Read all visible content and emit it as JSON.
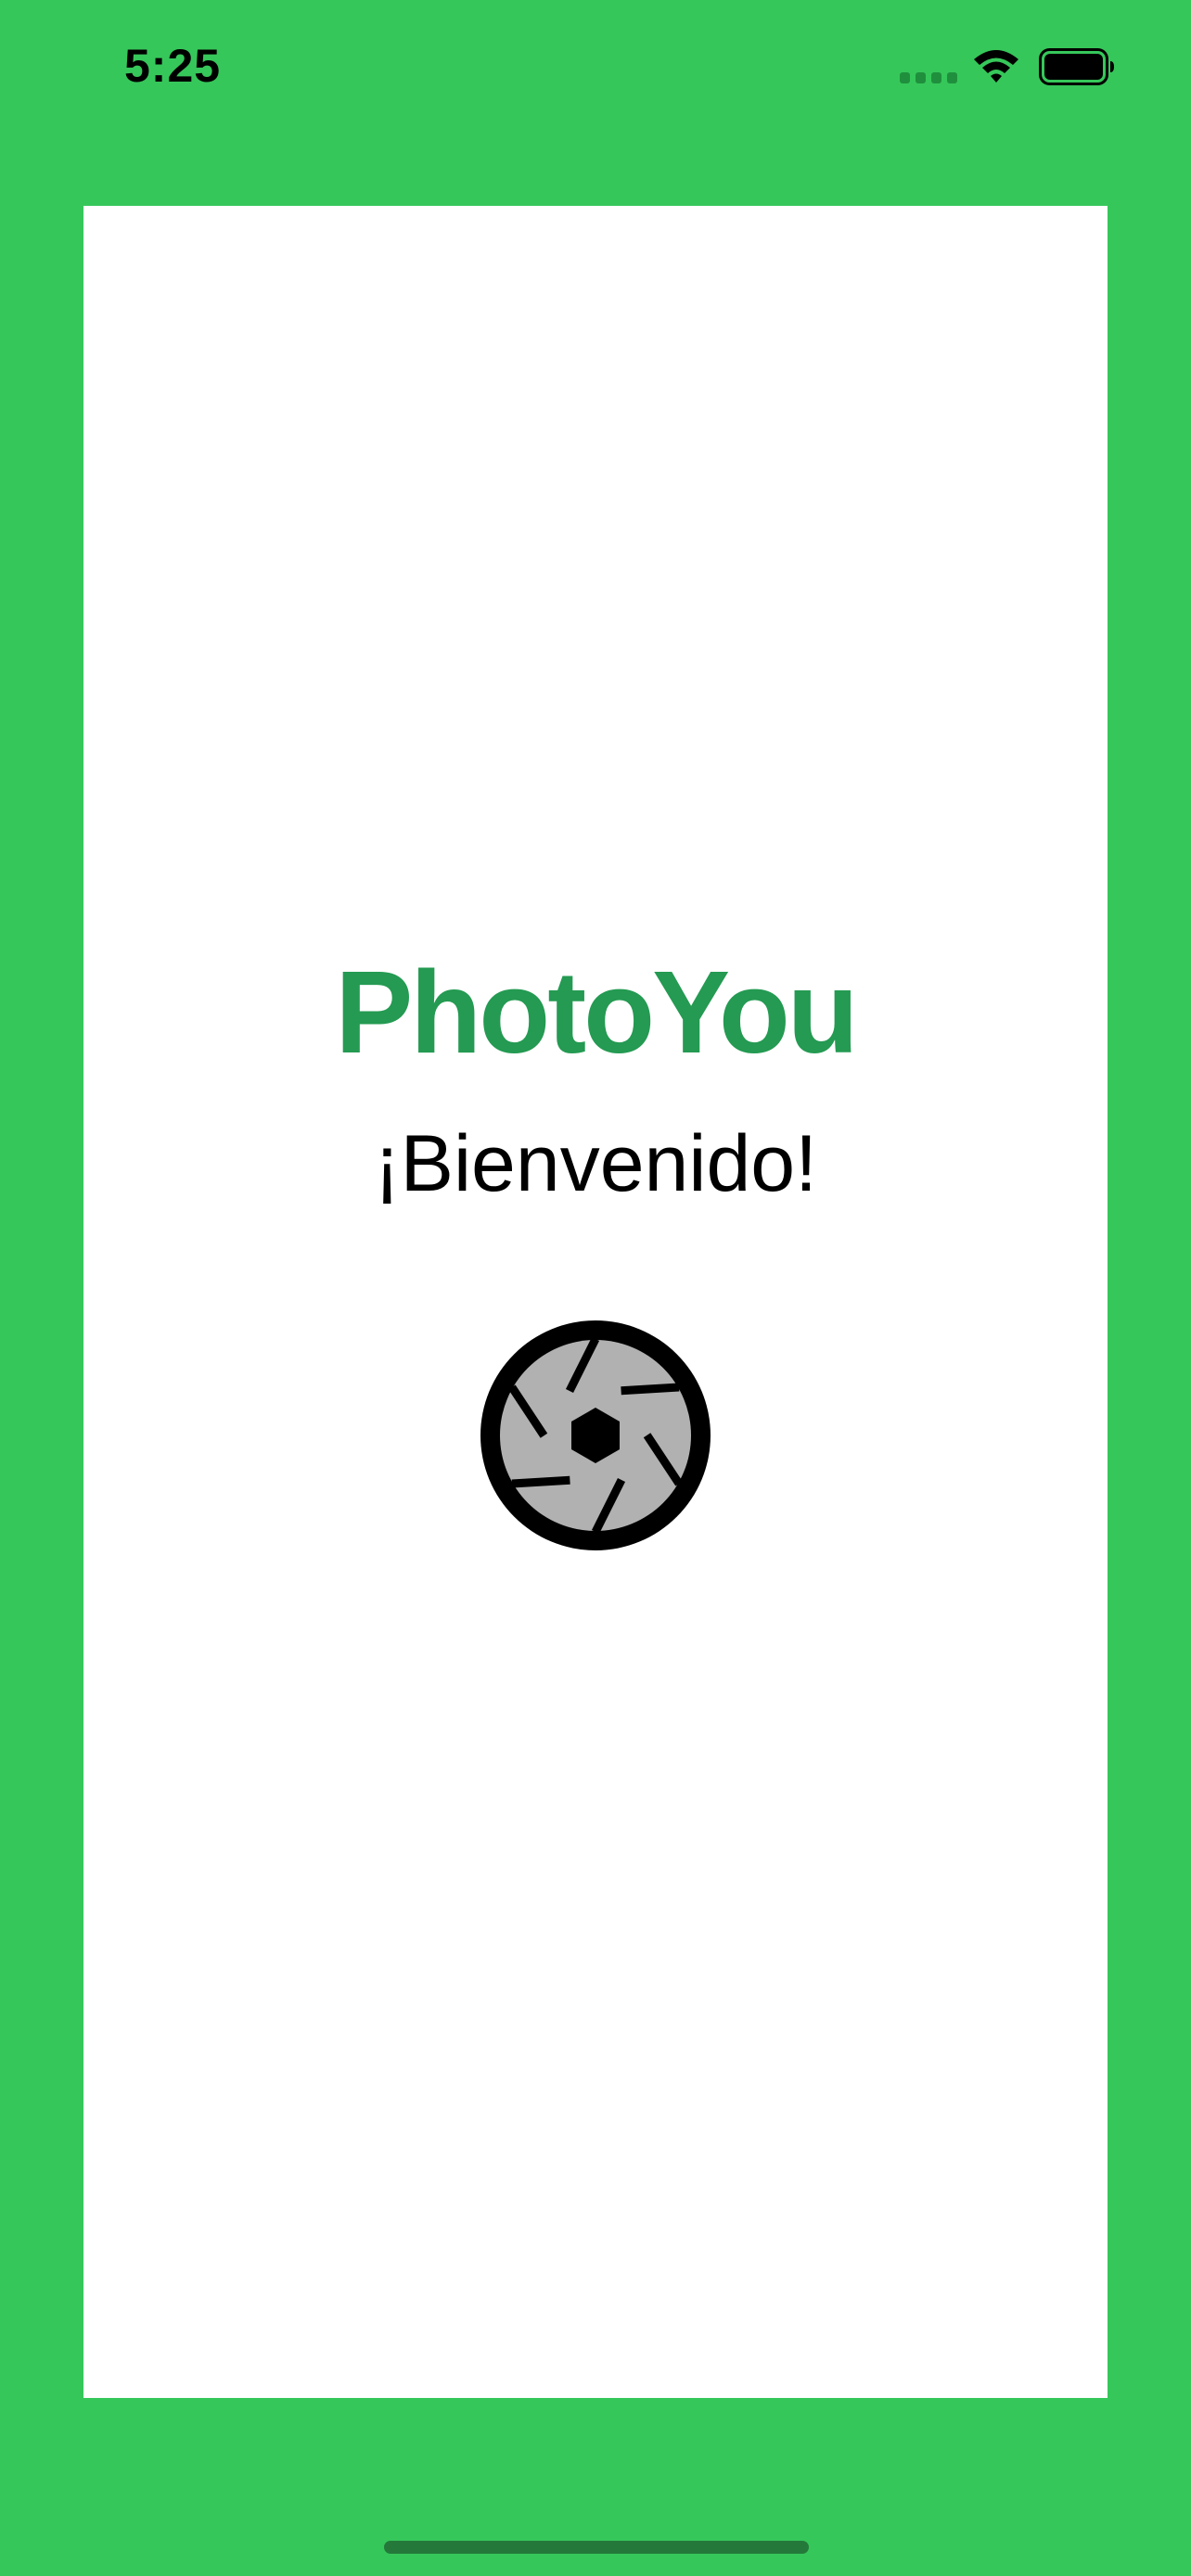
{
  "status_bar": {
    "time": "5:25",
    "signal_icon": "cellular-signal-icon",
    "wifi_icon": "wifi-icon",
    "battery_icon": "battery-full-icon"
  },
  "splash": {
    "title": "PhotoYou",
    "welcome": "¡Bienvenido!",
    "logo_icon": "camera-shutter-icon"
  },
  "colors": {
    "background": "#36c75a",
    "card": "#ffffff",
    "title": "#249a52",
    "text": "#000000",
    "shutter_blades": "#b1b1b1"
  }
}
